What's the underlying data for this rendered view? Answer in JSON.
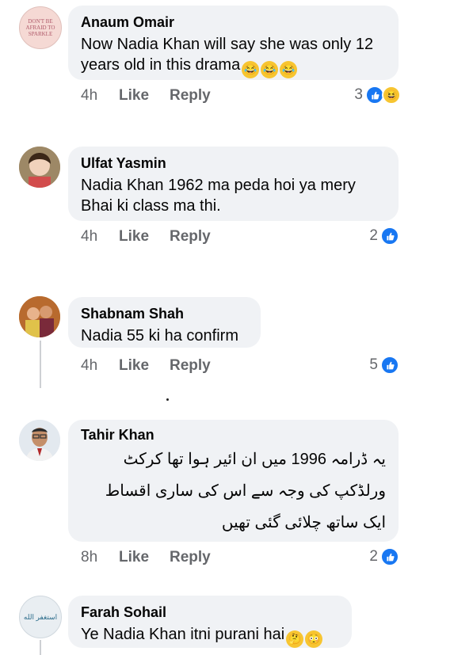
{
  "comments": [
    {
      "author": "Anaum Omair",
      "text": "Now Nadia Khan will say she was only 12 years old in this drama",
      "avatar_text": "DON'T BE AFRAID TO SPARKLE",
      "time": "4h",
      "like": "Like",
      "reply": "Reply",
      "reactions": "3",
      "reaction_icons": [
        "like-icon",
        "haha-icon"
      ]
    },
    {
      "author": "Ulfat Yasmin",
      "text": "Nadia Khan 1962 ma peda hoi ya mery Bhai ki class ma thi.",
      "time": "4h",
      "like": "Like",
      "reply": "Reply",
      "reactions": "2",
      "reaction_icons": [
        "like-icon"
      ]
    },
    {
      "author": "Shabnam Shah",
      "text": "Nadia 55 ki ha confirm",
      "time": "4h",
      "like": "Like",
      "reply": "Reply",
      "reactions": "5",
      "reaction_icons": [
        "like-icon"
      ]
    },
    {
      "author": "Tahir Khan",
      "text": "یہ ڈرامہ 1996 میں ان ائیر ہوا تھا کرکٹ ورلڈکپ کی وجہ سے اس کی ساری اقساط ایک ساتھ چلائی گئی تھیں",
      "time": "8h",
      "like": "Like",
      "reply": "Reply",
      "reactions": "2",
      "reaction_icons": [
        "like-icon"
      ]
    },
    {
      "author": "Farah Sohail",
      "text": "Ye Nadia Khan itni purani  hai",
      "avatar_text": "استغفر الله",
      "reaction_icons": []
    }
  ],
  "colors": {
    "like_blue": "#1877f2",
    "bubble_bg": "#f0f2f5",
    "meta_gray": "#65676b"
  }
}
